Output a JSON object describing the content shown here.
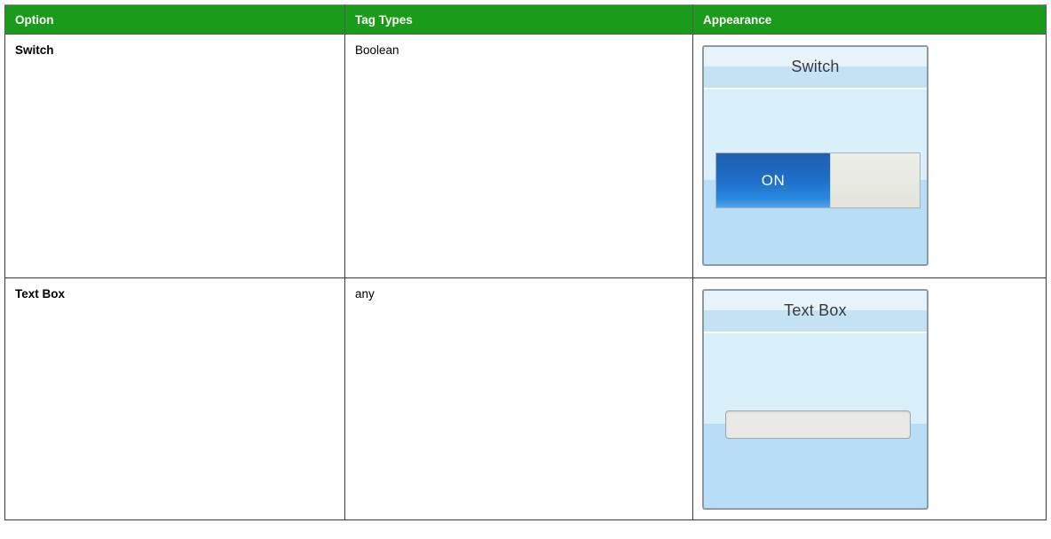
{
  "table": {
    "headers": {
      "option": "Option",
      "tag_types": "Tag Types",
      "appearance": "Appearance"
    },
    "rows": [
      {
        "option": "Switch",
        "tag_types": "Boolean",
        "appearance": {
          "widget_title": "Switch",
          "switch_state_label": "ON"
        }
      },
      {
        "option": "Text Box",
        "tag_types": "any",
        "appearance": {
          "widget_title": "Text Box",
          "textbox_value": ""
        }
      }
    ]
  },
  "colors": {
    "header_background": "#1a9b1a",
    "header_text": "#ffffff",
    "switch_on": "#1e6fc8",
    "panel_background": "#d9eff9"
  }
}
